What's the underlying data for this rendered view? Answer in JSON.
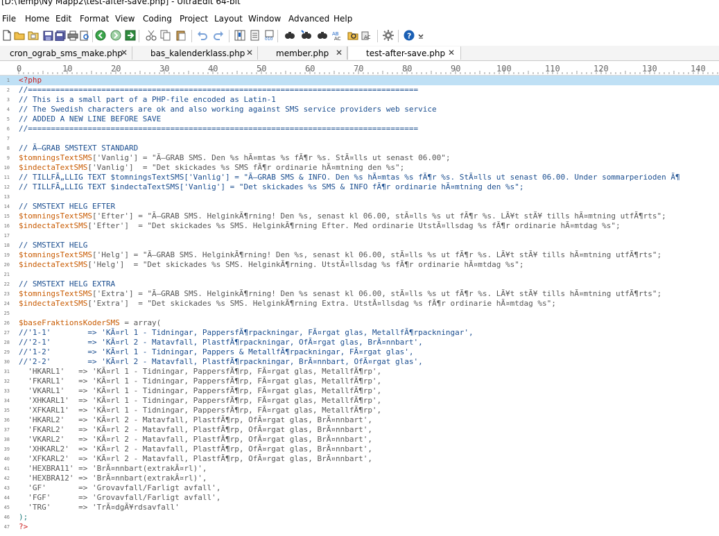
{
  "window": {
    "title": "[D:\\Temp\\Ny Mapp2\\test-after-save.php] - UltraEdit 64-bit"
  },
  "menu": [
    "File",
    "Home",
    "Edit",
    "Format",
    "View",
    "Coding",
    "Project",
    "Layout",
    "Window",
    "Advanced",
    "Help"
  ],
  "toolbar_icons": [
    "new-file-icon",
    "open-folder-icon",
    "open-file-icon",
    "save-icon",
    "save-all-icon",
    "print-icon",
    "print-preview-icon",
    "back-icon",
    "forward-icon",
    "goto-icon",
    "cut-icon",
    "copy-icon",
    "paste-icon",
    "undo-icon",
    "redo-icon",
    "column-mode-icon",
    "hex-edit-icon",
    "binary-icon",
    "find-icon",
    "find-in-files-icon",
    "find-prev-icon",
    "spell-check-icon",
    "find-folder-icon",
    "replace-icon",
    "settings-icon",
    "help-icon"
  ],
  "tabs": [
    {
      "label": "cron_ograb_sms_make.php",
      "close": "✕"
    },
    {
      "label": "bas_kalenderklass.php",
      "close": "✕"
    },
    {
      "label": "member.php",
      "close": "✕"
    },
    {
      "label": "test-after-save.php",
      "close": "✕"
    }
  ],
  "ruler": [
    "0",
    "10",
    "20",
    "30",
    "40",
    "50",
    "60",
    "70",
    "80",
    "90",
    "100",
    "110",
    "120",
    "130",
    "140"
  ],
  "editor": {
    "lines": [
      "<?php",
      "//=====================================================================================",
      "// This is a small part of a PHP-file encoded as Latin-1",
      "// The Swedish characters are ok and also working against SMS service providers web service",
      "// ADDED A NEW LINE BEFORE SAVE",
      "//=====================================================================================",
      "",
      "// Ã–GRAB SMSTEXT STANDARD",
      "$tomningsTextSMS['Vanlig'] = \"Ã–GRAB SMS. Den %s hÃ¤mtas %s fÃ¶r %s. StÃ¤lls ut senast 06.00\";",
      "$indectaTextSMS['Vanlig']  = \"Det skickades %s SMS fÃ¶r ordinarie hÃ¤mtning den %s\";",
      "// TILLFÃ„LLIG TEXT $tomningsTextSMS['Vanlig'] = \"Ã–GRAB SMS & INFO. Den %s hÃ¤mtas %s fÃ¶r %s. StÃ¤lls ut senast 06.00. Under sommarperioden Ã¶",
      "// TILLFÃ„LLIG TEXT $indectaTextSMS['Vanlig'] = \"Det skickades %s SMS & INFO fÃ¶r ordinarie hÃ¤mtning den %s\";",
      "",
      "// SMSTEXT HELG EFTER",
      "$tomningsTextSMS['Efter'] = \"Ã–GRAB SMS. HelginkÃ¶rning! Den %s, senast kl 06.00, stÃ¤lls %s ut fÃ¶r %s. LÃ¥t stÃ¥ tills hÃ¤mtning utfÃ¶rts\";",
      "$indectaTextSMS['Efter']  = \"Det skickades %s SMS. HelginkÃ¶rning Efter. Med ordinarie UtstÃ¤llsdag %s fÃ¶r ordinarie hÃ¤mtdag %s\";",
      "",
      "// SMSTEXT HELG",
      "$tomningsTextSMS['Helg'] = \"Ã–GRAB SMS. HelginkÃ¶rning! Den %s, senast kl 06.00, stÃ¤lls %s ut fÃ¶r %s. LÃ¥t stÃ¥ tills hÃ¤mtning utfÃ¶rts\";",
      "$indectaTextSMS['Helg']  = \"Det skickades %s SMS. HelginkÃ¶rning. UtstÃ¤llsdag %s fÃ¶r ordinarie hÃ¤mtdag %s\";",
      "",
      "// SMSTEXT HELG EXTRA",
      "$tomningsTextSMS['Extra'] = \"Ã–GRAB SMS. HelginkÃ¶rning! Den %s senast kl 06.00, stÃ¤lls %s ut fÃ¶r %s. LÃ¥t stÃ¥ tills hÃ¤mtning utfÃ¶rts\";",
      "$indectaTextSMS['Extra']  = \"Det skickades %s SMS. HelginkÃ¶rning Extra. UtstÃ¤llsdag %s fÃ¶r ordinarie hÃ¤mtdag %s\";",
      "",
      "$baseFraktionsKoderSMS = array(",
      "//'1-1'        => 'KÃ¤rl 1 - Tidningar, PappersfÃ¶rpackningar, FÃ¤rgat glas, MetallfÃ¶rpackningar',",
      "//'2-1'        => 'KÃ¤rl 2 - Matavfall, PlastfÃ¶rpackningar, OfÃ¤rgat glas, BrÃ¤nnbart',",
      "//'1-2'        => 'KÃ¤rl 1 - Tidningar, Pappers & MetallfÃ¶rpackningar, FÃ¤rgat glas',",
      "//'2-2'        => 'KÃ¤rl 2 - Matavfall, PlastfÃ¶rpackningar, BrÃ¤nnbart, OfÃ¤rgat glas',",
      "  'HKARL1'   => 'KÃ¤rl 1 - Tidningar, PappersfÃ¶rp, FÃ¤rgat glas, MetallfÃ¶rp',",
      "  'FKARL1'   => 'KÃ¤rl 1 - Tidningar, PappersfÃ¶rp, FÃ¤rgat glas, MetallfÃ¶rp',",
      "  'VKARL1'   => 'KÃ¤rl 1 - Tidningar, PappersfÃ¶rp, FÃ¤rgat glas, MetallfÃ¶rp',",
      "  'XHKARL1'  => 'KÃ¤rl 1 - Tidningar, PappersfÃ¶rp, FÃ¤rgat glas, MetallfÃ¶rp',",
      "  'XFKARL1'  => 'KÃ¤rl 1 - Tidningar, PappersfÃ¶rp, FÃ¤rgat glas, MetallfÃ¶rp',",
      "  'HKARL2'   => 'KÃ¤rl 2 - Matavfall, PlastfÃ¶rp, OfÃ¤rgat glas, BrÃ¤nnbart',",
      "  'FKARL2'   => 'KÃ¤rl 2 - Matavfall, PlastfÃ¶rp, OfÃ¤rgat glas, BrÃ¤nnbart',",
      "  'VKARL2'   => 'KÃ¤rl 2 - Matavfall, PlastfÃ¶rp, OfÃ¤rgat glas, BrÃ¤nnbart',",
      "  'XHKARL2'  => 'KÃ¤rl 2 - Matavfall, PlastfÃ¶rp, OfÃ¤rgat glas, BrÃ¤nnbart',",
      "  'XFKARL2'  => 'KÃ¤rl 2 - Matavfall, PlastfÃ¶rp, OfÃ¤rgat glas, BrÃ¤nnbart',",
      "  'HEXBRA11' => 'BrÃ¤nnbart(extrakÃ¤rl)',",
      "  'HEXBRA12' => 'BrÃ¤nnbart(extrakÃ¤rl)',",
      "  'GF'       => 'Grovavfall/Farligt avfall',",
      "  'FGF'      => 'Grovavfall/Farligt avfall',",
      "  'TRG'      => 'TrÃ¤dgÃ¥rdsavfall'",
      ");",
      "?>"
    ]
  }
}
